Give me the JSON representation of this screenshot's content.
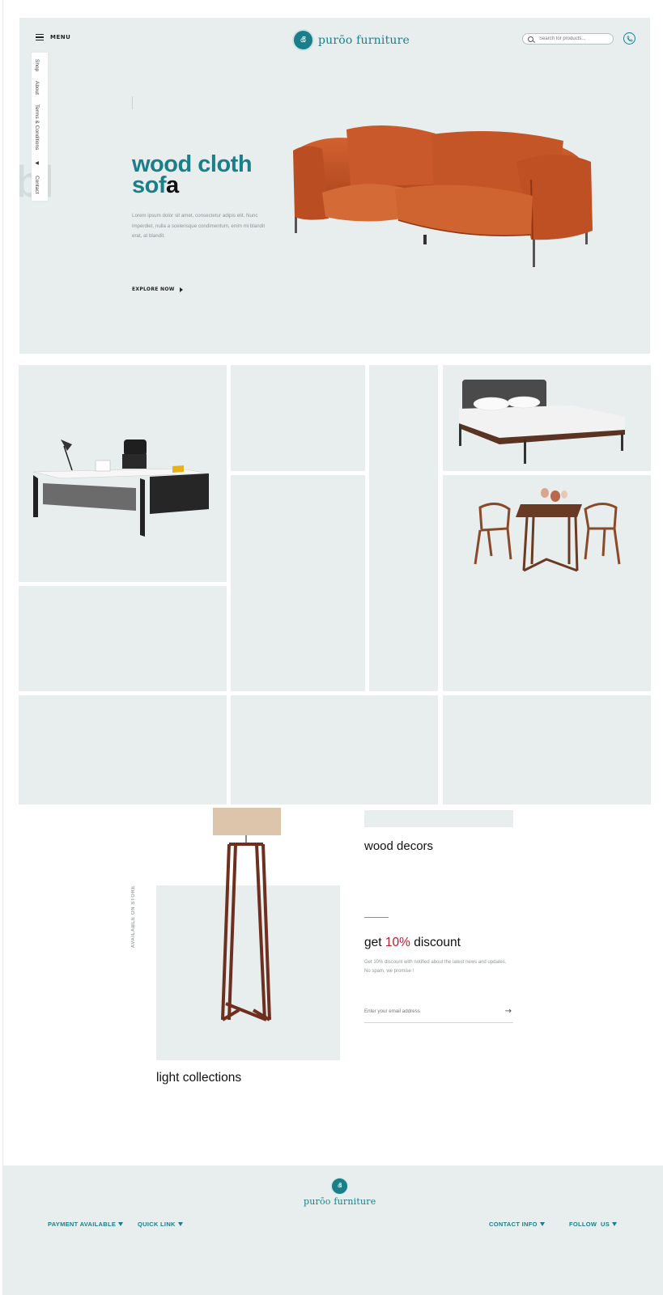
{
  "header": {
    "menu_label": "MENU",
    "logo_mark": "ශි",
    "logo_text": "purōo furniture",
    "search_placeholder": "Search for products...",
    "search_icon": "search-icon",
    "phone_icon": "phone-icon"
  },
  "side_nav": {
    "items": [
      "Shop",
      "About",
      "Terms & Conditions"
    ],
    "contact": "Contact"
  },
  "hero": {
    "title_line1": "wood cloth",
    "title_line2_colored": "sof",
    "title_line2_dark": "a",
    "description": "Lorem ipsum dolor sit amet, consectetur adipis elit. Nunc imperdiet, nulla a scelerisque condimentum, enim mi blandit erat, at blandit.",
    "cta_label": "EXPLORE NOW"
  },
  "collections": {
    "availability_label": "AVAILABLE ON STORE",
    "light_title": "light collections",
    "decor_title": "wood decors"
  },
  "newsletter": {
    "title_prefix": "get ",
    "title_highlight": "10%",
    "title_suffix": " discount",
    "description": "Get 10% discount with notified about the latest news and updates. No spam, we promise !",
    "email_placeholder": "Enter your email address",
    "submit_icon": "arrow-right-icon"
  },
  "footer": {
    "payment": "PAYMENT AVAILABLE",
    "quick_link": "QUICK LINK",
    "logo_mark": "ශි",
    "logo_text": "purōo furniture",
    "contact_info": "CONTACT INFO",
    "follow_us": "FOLLOW  US"
  },
  "colors": {
    "accent": "#1a7f88",
    "highlight": "#b3202e",
    "panel": "#e8eeee"
  }
}
